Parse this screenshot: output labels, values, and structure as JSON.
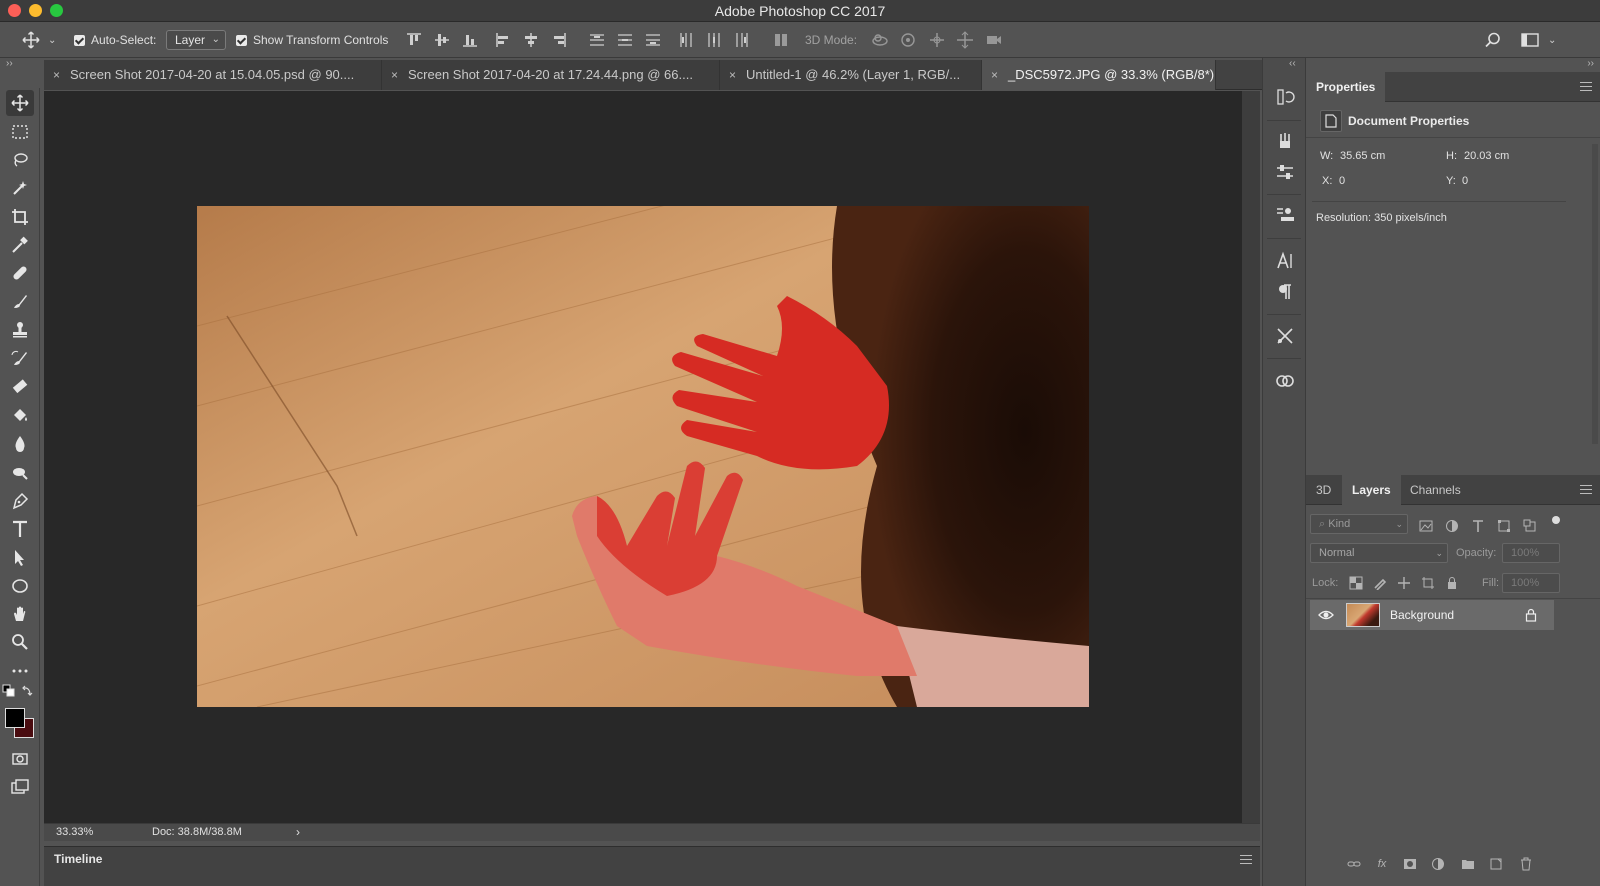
{
  "app": {
    "title": "Adobe Photoshop CC 2017"
  },
  "options_bar": {
    "auto_select_label": "Auto-Select:",
    "auto_select_checked": true,
    "auto_select_value": "Layer",
    "show_transform_label": "Show Transform Controls",
    "show_transform_checked": true,
    "mode_3d_label": "3D Mode:"
  },
  "tabs": [
    {
      "label": "Screen Shot 2017-04-20 at 15.04.05.psd @ 90....",
      "close": "×",
      "active": false
    },
    {
      "label": "Screen Shot 2017-04-20 at 17.24.44.png @ 66....",
      "close": "×",
      "active": false
    },
    {
      "label": "Untitled-1 @ 46.2% (Layer 1, RGB/...",
      "close": "×",
      "active": false
    },
    {
      "label": "_DSC5972.JPG @ 33.3% (RGB/8*)",
      "close": "×",
      "active": true
    }
  ],
  "status": {
    "zoom": "33.33%",
    "doc": "Doc: 38.8M/38.8M",
    "arrow": "›"
  },
  "timeline": {
    "label": "Timeline"
  },
  "properties": {
    "tab": "Properties",
    "section": "Document Properties",
    "w_label": "W:",
    "w_value": "35.65 cm",
    "h_label": "H:",
    "h_value": "20.03 cm",
    "x_label": "X:",
    "x_value": "0",
    "y_label": "Y:",
    "y_value": "0",
    "resolution": "Resolution: 350 pixels/inch"
  },
  "layers_panel": {
    "tabs": [
      "3D",
      "Layers",
      "Channels"
    ],
    "active_tab": "Layers",
    "filter_kind": "Kind",
    "blend_mode": "Normal",
    "opacity_label": "Opacity:",
    "opacity_value": "100%",
    "lock_label": "Lock:",
    "fill_label": "Fill:",
    "fill_value": "100%",
    "layers": [
      {
        "name": "Background",
        "visible": true,
        "locked": true
      }
    ]
  },
  "colors": {
    "foreground": "#000000",
    "background": "#4a0c10",
    "canvas_bg": "#282828",
    "ui_bg": "#535353"
  }
}
